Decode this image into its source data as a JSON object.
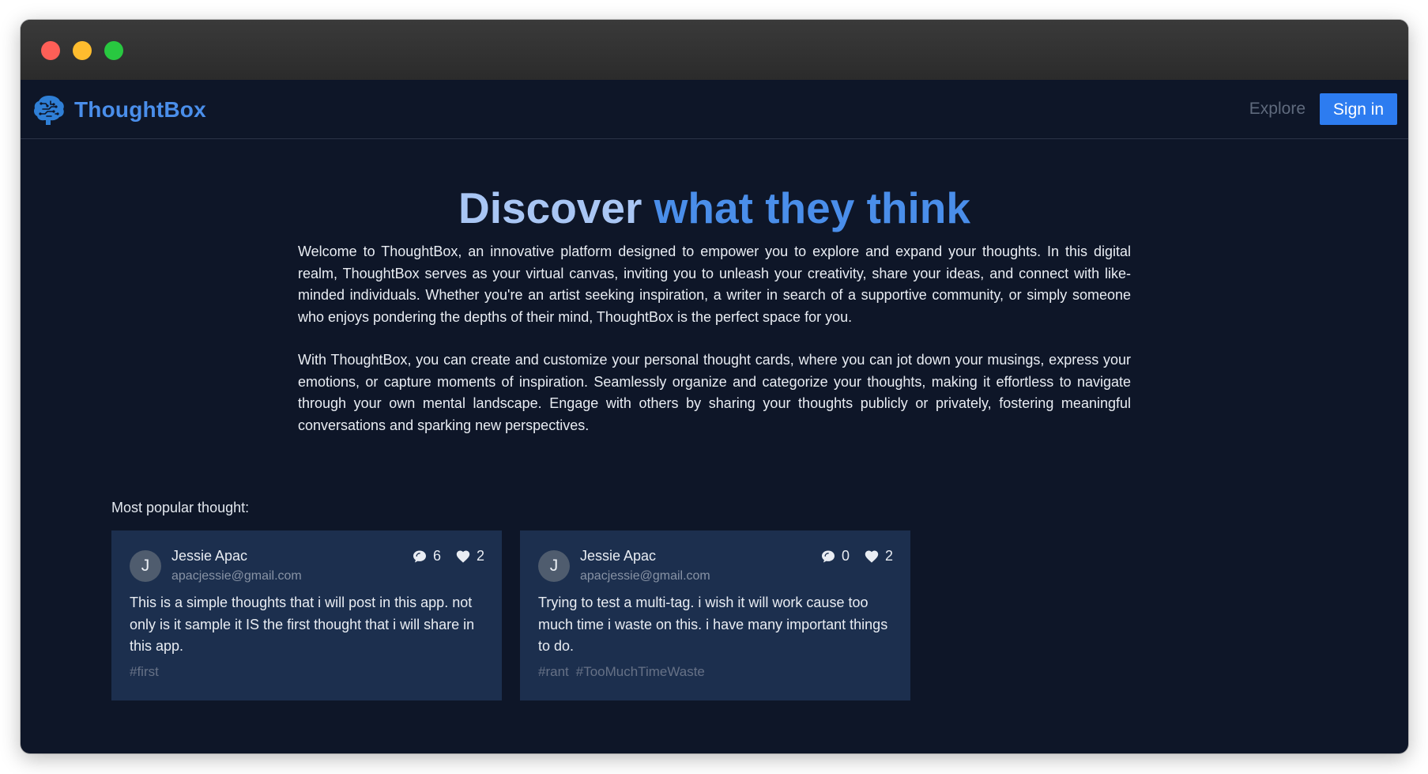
{
  "app": {
    "brand_name": "ThoughtBox",
    "brand_color": "#4a8eea"
  },
  "nav": {
    "explore_label": "Explore",
    "signin_label": "Sign in",
    "signin_color": "#2d7cf0"
  },
  "hero": {
    "title_part1": "Discover",
    "title_part2": "what they think",
    "paragraph1": "Welcome to ThoughtBox, an innovative platform designed to empower you to explore and expand your thoughts. In this digital realm, ThoughtBox serves as your virtual canvas, inviting you to unleash your creativity, share your ideas, and connect with like-minded individuals. Whether you're an artist seeking inspiration, a writer in search of a supportive community, or simply someone who enjoys pondering the depths of their mind, ThoughtBox is the perfect space for you.",
    "paragraph2": "With ThoughtBox, you can create and customize your personal thought cards, where you can jot down your musings, express your emotions, or capture moments of inspiration. Seamlessly organize and categorize your thoughts, making it effortless to navigate through your own mental landscape. Engage with others by sharing your thoughts publicly or privately, fostering meaningful conversations and sparking new perspectives."
  },
  "popular": {
    "label": "Most popular thought:",
    "thoughts": [
      {
        "avatar_letter": "J",
        "author": "Jessie Apac",
        "email": "apacjessie@gmail.com",
        "comments": "6",
        "likes": "2",
        "comment_icon": "comment-icon",
        "like_icon": "heart-icon",
        "body": "This is a simple thoughts that i will post in this app. not only is it sample it IS the first thought that i will share in this app.",
        "tags": [
          "#first"
        ]
      },
      {
        "avatar_letter": "J",
        "author": "Jessie Apac",
        "email": "apacjessie@gmail.com",
        "comments": "0",
        "likes": "2",
        "comment_icon": "comment-icon",
        "like_icon": "heart-icon",
        "body": "Trying to test a multi-tag. i wish it will work cause too much time i waste on this. i have many important things to do.",
        "tags": [
          "#rant",
          "#TooMuchTimeWaste"
        ]
      }
    ]
  }
}
